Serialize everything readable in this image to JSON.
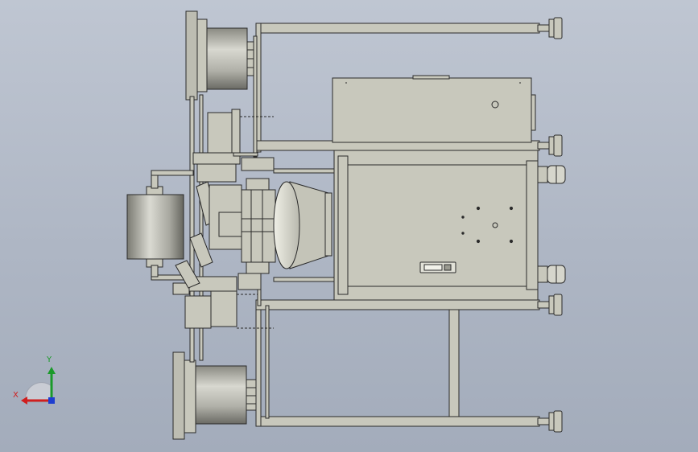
{
  "view": {
    "background_top": "#bfc6d2",
    "background_bottom": "#a3acbb",
    "part_color": "#c8c8bc",
    "edge_color": "#2a2a2a"
  },
  "triad": {
    "x_label": "X",
    "y_label": "Y",
    "x_color": "#d01e1e",
    "y_color": "#1a9a2a",
    "z_color": "#1e3ed0"
  }
}
